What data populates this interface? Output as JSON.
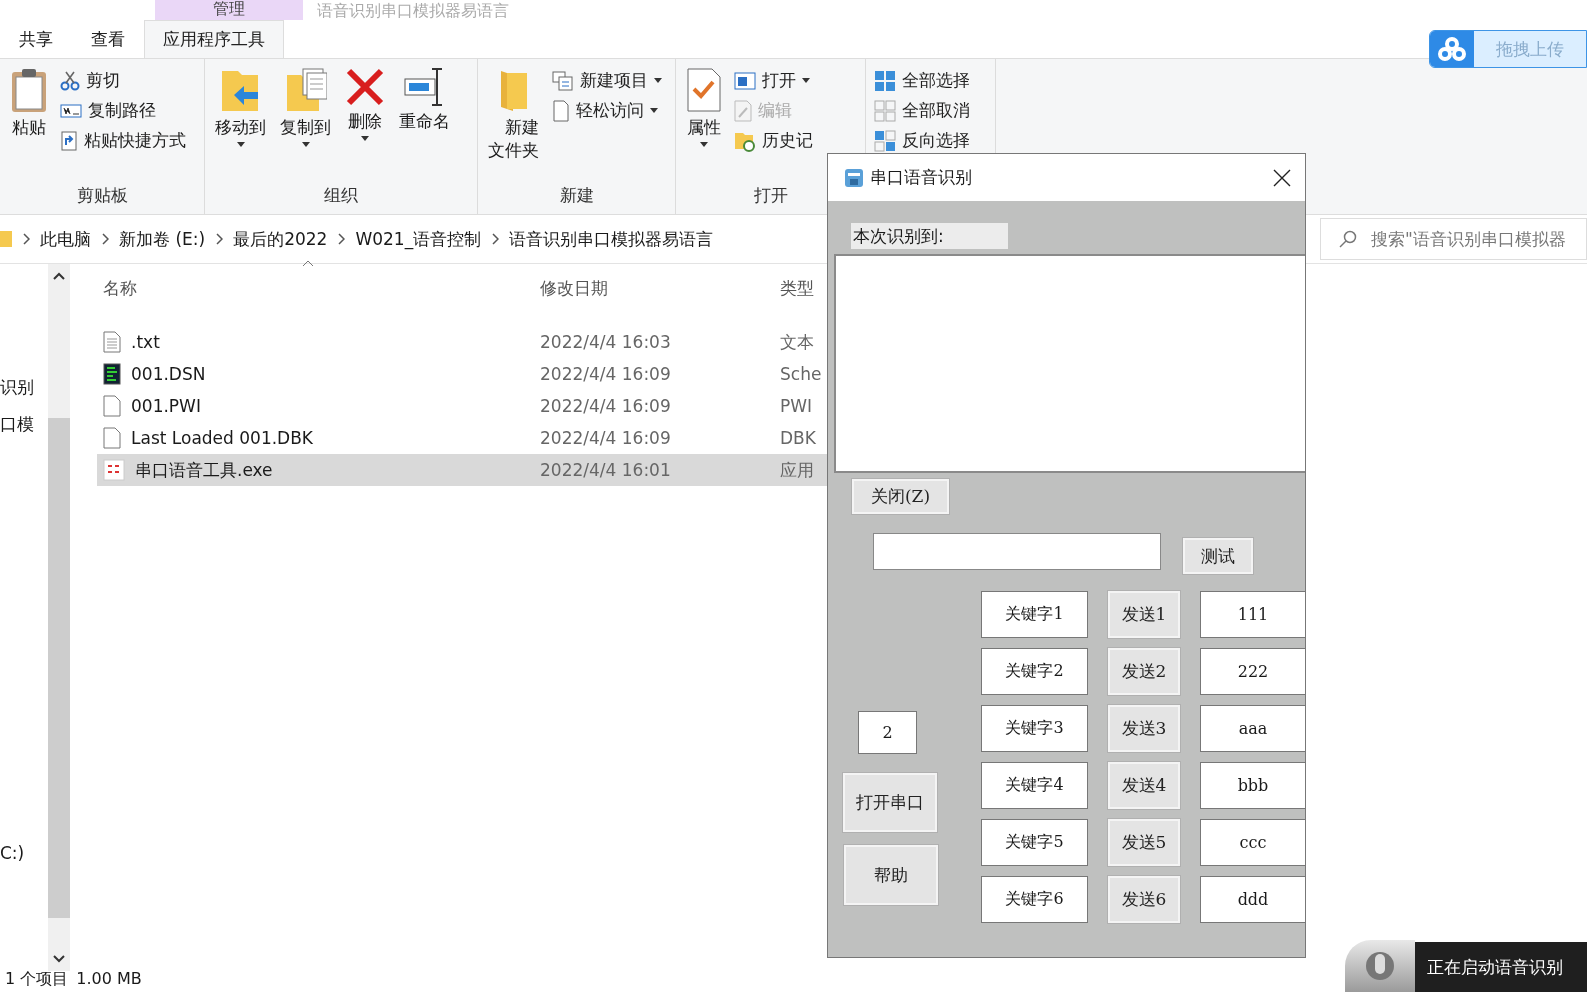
{
  "explorer": {
    "context_tab": {
      "label": "管理"
    },
    "window": {
      "title": "语音识别串口模拟器易语言"
    },
    "tabs": [
      {
        "label": "共享",
        "selected": false
      },
      {
        "label": "查看",
        "selected": false
      },
      {
        "label": "应用程序工具",
        "selected": true
      }
    ],
    "upload_button": {
      "label": "拖拽上传"
    },
    "ribbon": {
      "groups": [
        {
          "label": "剪贴板",
          "items": [
            {
              "kind": "large",
              "label": "粘贴",
              "dropdown": false,
              "disabled": false
            },
            {
              "kind": "small",
              "label": "剪切",
              "dropdown": false,
              "disabled": false
            },
            {
              "kind": "small",
              "label": "复制路径",
              "dropdown": false,
              "disabled": false
            },
            {
              "kind": "small",
              "label": "粘贴快捷方式",
              "dropdown": false,
              "disabled": false
            }
          ]
        },
        {
          "label": "组织",
          "items": [
            {
              "kind": "large",
              "label": "移动到",
              "dropdown": true,
              "disabled": false
            },
            {
              "kind": "large",
              "label": "复制到",
              "dropdown": true,
              "disabled": false
            },
            {
              "kind": "large",
              "label": "删除",
              "dropdown": true,
              "disabled": false
            },
            {
              "kind": "large",
              "label": "重命名",
              "dropdown": false,
              "disabled": false
            }
          ]
        },
        {
          "label": "新建",
          "items": [
            {
              "kind": "large",
              "label": "新建文件夹",
              "dropdown": false,
              "disabled": false
            },
            {
              "kind": "small",
              "label": "新建项目",
              "dropdown": true,
              "disabled": false
            },
            {
              "kind": "small",
              "label": "轻松访问",
              "dropdown": true,
              "disabled": false
            }
          ]
        },
        {
          "label": "打开",
          "items": [
            {
              "kind": "large",
              "label": "属性",
              "dropdown": true,
              "disabled": false
            },
            {
              "kind": "small",
              "label": "打开",
              "dropdown": true,
              "disabled": false
            },
            {
              "kind": "small",
              "label": "编辑",
              "dropdown": false,
              "disabled": true
            },
            {
              "kind": "small",
              "label": "历史记",
              "dropdown": false,
              "disabled": false
            }
          ]
        },
        {
          "items": [
            {
              "kind": "small",
              "label": "全部选择",
              "dropdown": false,
              "disabled": false
            },
            {
              "kind": "small",
              "label": "全部取消",
              "dropdown": false,
              "disabled": false
            },
            {
              "kind": "small",
              "label": "反向选择",
              "dropdown": false,
              "disabled": false
            }
          ]
        }
      ]
    },
    "address_bar": {
      "crumbs": [
        "此电脑",
        "新加卷 (E:)",
        "最后的2022",
        "W021_语音控制",
        "语音识别串口模拟器易语言"
      ]
    },
    "search": {
      "placeholder": "搜索\"语音识别串口模拟器"
    },
    "nav_pane": {
      "items": [
        {
          "kind": "folder",
          "label": "识别"
        },
        {
          "kind": "folder",
          "label": "口模"
        },
        {
          "kind": "drive",
          "label": "C:)"
        }
      ]
    },
    "file_list": {
      "columns": [
        "名称",
        "修改日期",
        "类型"
      ],
      "rows": [
        {
          "kind": "text",
          "name": ".txt",
          "date": "2022/4/4 16:03",
          "type": "文本",
          "selected": false
        },
        {
          "kind": "dsn",
          "name": "001.DSN",
          "date": "2022/4/4 16:09",
          "type": "Sche",
          "selected": false
        },
        {
          "kind": "blank",
          "name": "001.PWI",
          "date": "2022/4/4 16:09",
          "type": "PWI",
          "selected": false
        },
        {
          "kind": "blank",
          "name": "Last Loaded 001.DBK",
          "date": "2022/4/4 16:09",
          "type": "DBK",
          "selected": false
        },
        {
          "kind": "exe",
          "name": "串口语音工具.exe",
          "date": "2022/4/4 16:01",
          "type": "应用",
          "selected": true
        }
      ]
    },
    "status_bar": {
      "count": "1 个项目",
      "size": "1.00 MB"
    }
  },
  "dialog": {
    "title": "串口语音识别",
    "result_label": "本次识别到:",
    "close_button": "关闭(Z)",
    "test_button": "测试",
    "port_value": "2",
    "open_port_button": "打开串口",
    "help_button": "帮助",
    "rows": [
      {
        "keyword": "关键字1",
        "send": "发送1",
        "value": "111"
      },
      {
        "keyword": "关键字2",
        "send": "发送2",
        "value": "222"
      },
      {
        "keyword": "关键字3",
        "send": "发送3",
        "value": "aaa"
      },
      {
        "keyword": "关键字4",
        "send": "发送4",
        "value": "bbb"
      },
      {
        "keyword": "关键字5",
        "send": "发送5",
        "value": "ccc"
      },
      {
        "keyword": "关键字6",
        "send": "发送6",
        "value": "ddd"
      }
    ]
  },
  "voice_widget": {
    "status": "正在启动语音识别"
  }
}
